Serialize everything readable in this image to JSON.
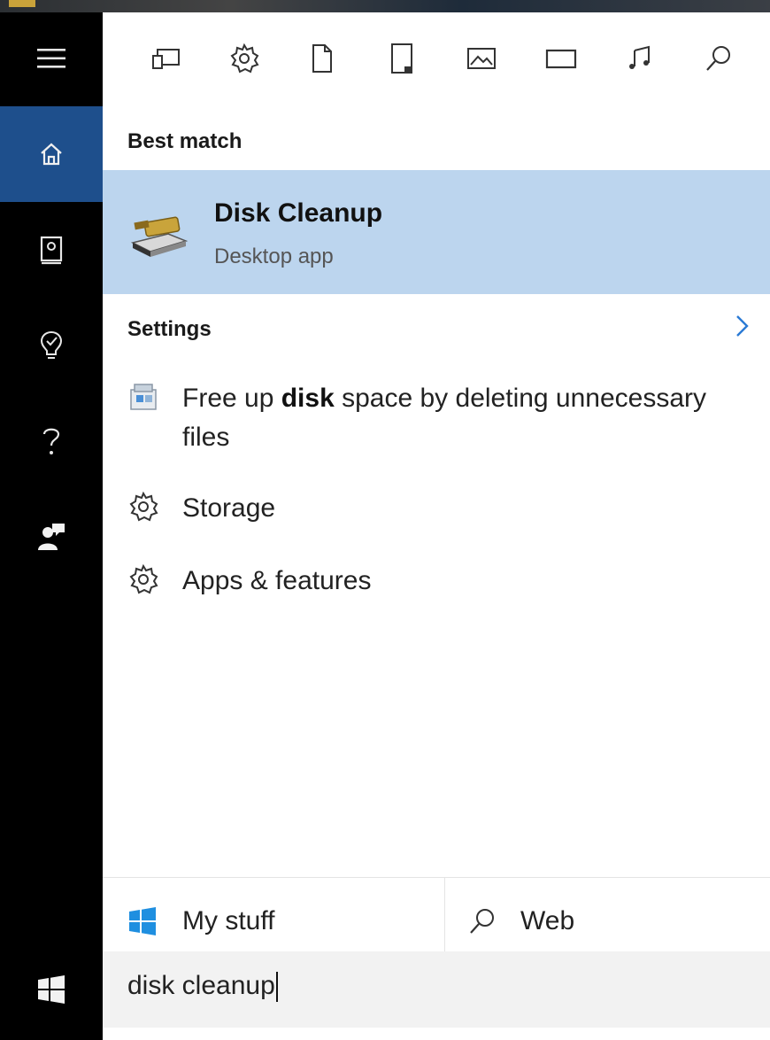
{
  "filters": {
    "icons": [
      "apps-icon",
      "settings-icon",
      "documents-icon",
      "folders-icon",
      "photos-icon",
      "videos-icon",
      "music-icon",
      "search-icon"
    ]
  },
  "sidebar": {
    "items": [
      {
        "icon": "menu-icon"
      },
      {
        "icon": "home-icon",
        "active": true
      },
      {
        "icon": "notebook-icon"
      },
      {
        "icon": "lightbulb-icon"
      },
      {
        "icon": "help-icon"
      },
      {
        "icon": "feedback-icon"
      }
    ]
  },
  "best_match": {
    "heading": "Best match",
    "title": "Disk Cleanup",
    "subtitle": "Desktop app"
  },
  "settings": {
    "heading": "Settings",
    "items": [
      {
        "prefix": "Free up ",
        "bold": "disk",
        "suffix": " space by deleting unnecessary files",
        "icon": "control-panel-icon"
      },
      {
        "text": "Storage",
        "icon": "gear-icon"
      },
      {
        "text": "Apps & features",
        "icon": "gear-icon"
      }
    ]
  },
  "bottom_tabs": {
    "my_stuff": "My stuff",
    "web": "Web"
  },
  "search": {
    "value": "disk cleanup"
  },
  "colors": {
    "rail_bg": "#000000",
    "rail_active": "#1e4f8c",
    "selection": "#bcd5ee",
    "accent": "#2a7ad5",
    "windows_blue": "#1f8fe0"
  }
}
